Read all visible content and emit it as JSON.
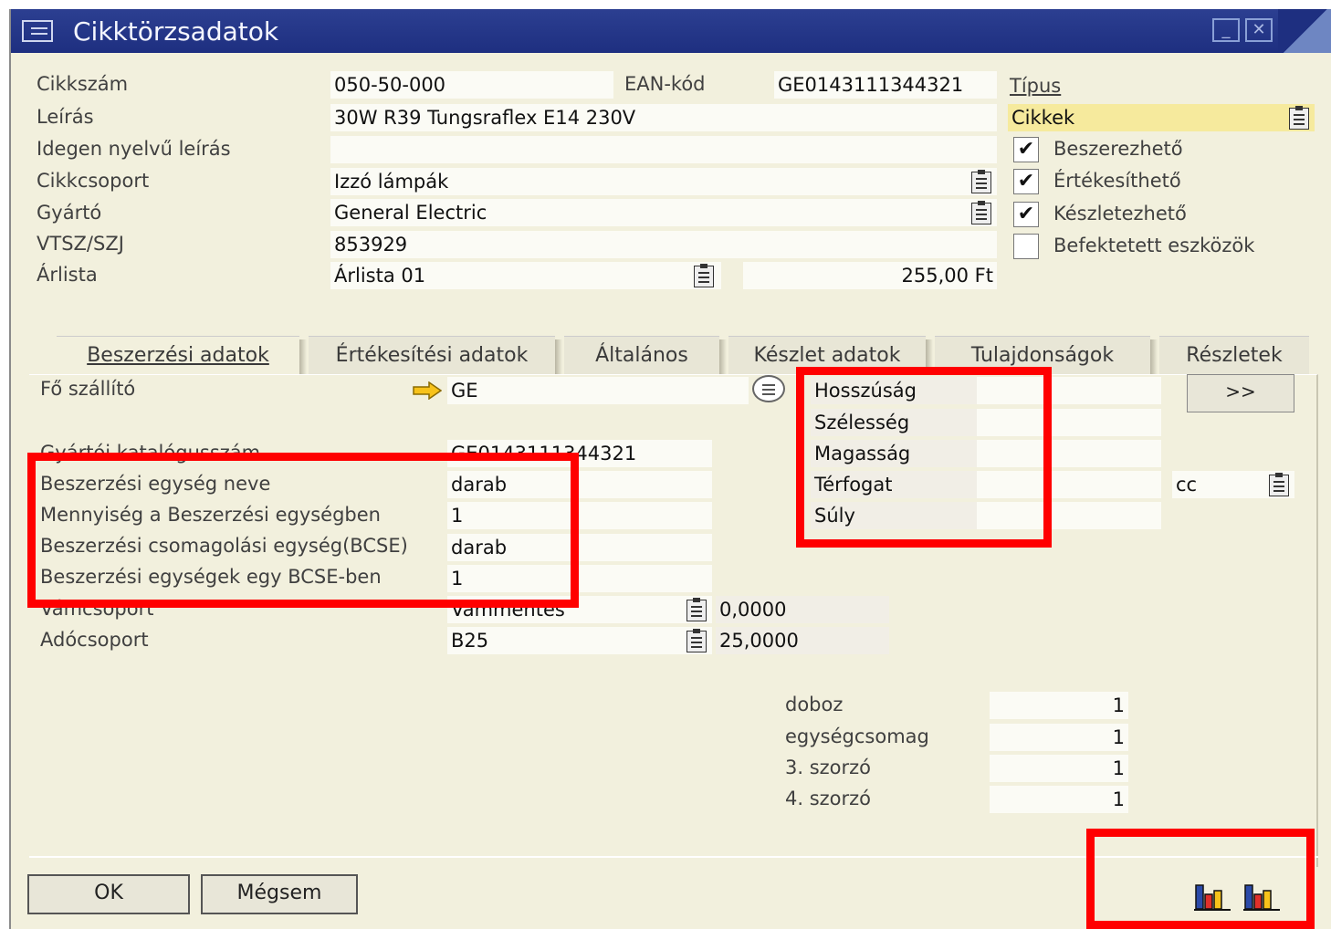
{
  "window": {
    "title": "Cikktörzsadatok",
    "minimize_icon": "minimize-icon",
    "close_icon": "close-icon"
  },
  "header": {
    "item_no_label": "Cikkszám",
    "item_no": "050-50-000",
    "ean_label": "EAN-kód",
    "ean": "GE0143111344321",
    "desc_label": "Leírás",
    "desc": "30W R39 Tungsraflex E14 230V",
    "foreign_desc_label": "Idegen nyelvű leírás",
    "foreign_desc": "",
    "group_label": "Cikkcsoport",
    "group": "Izzó lámpák",
    "manufacturer_label": "Gyártó",
    "manufacturer": "General Electric",
    "vtsz_label": "VTSZ/SZJ",
    "vtsz": "853929",
    "pricelist_label": "Árlista",
    "pricelist": "Árlista 01",
    "price": "255,00 Ft",
    "type_label": "Típus",
    "type": "Cikkek"
  },
  "flags": [
    {
      "label": "Beszerezhető",
      "checked": true
    },
    {
      "label": "Értékesíthető",
      "checked": true
    },
    {
      "label": "Készletezhető",
      "checked": true
    },
    {
      "label": "Befektetett eszközök",
      "checked": false
    }
  ],
  "tabs": [
    "Beszerzési adatok",
    "Értékesítési adatok",
    "Általános",
    "Készlet adatok",
    "Tulajdonságok",
    "Részletek"
  ],
  "purchasing": {
    "main_supplier_label": "Fő szállító",
    "main_supplier": "GE",
    "catalog_label": "Gyártói katalógusszám",
    "catalog": "GE0143111344321",
    "uom_name_label": "Beszerzési egység neve",
    "uom_name": "darab",
    "qty_per_uom_label": "Mennyiség a Beszerzési egységben",
    "qty_per_uom": "1",
    "pack_uom_label": "Beszerzési csomagolási egység(BCSE)",
    "pack_uom": "darab",
    "units_per_pack_label": "Beszerzési egységek egy BCSE-ben",
    "units_per_pack": "1",
    "customs_label": "Vámcsoport",
    "customs": "Vámmentes",
    "customs_rate": "0,0000",
    "tax_label": "Adócsoport",
    "tax": "B25",
    "tax_rate": "25,0000"
  },
  "dimensions": {
    "length_label": "Hosszúság",
    "width_label": "Szélesség",
    "height_label": "Magasság",
    "volume_label": "Térfogat",
    "weight_label": "Súly",
    "volume_unit": "cc",
    "more_button": ">>"
  },
  "packaging": [
    {
      "label": "doboz",
      "value": "1"
    },
    {
      "label": "egységcsomag",
      "value": "1"
    },
    {
      "label": "3. szorzó",
      "value": "1"
    },
    {
      "label": "4. szorzó",
      "value": "1"
    }
  ],
  "footer": {
    "ok_label": "OK",
    "cancel_label": "Mégsem"
  },
  "colors": {
    "title_bar": "#1e2f80",
    "highlight": "#ff0000",
    "type_field": "#f6ea9d",
    "window_bg": "#f2f0dd"
  }
}
